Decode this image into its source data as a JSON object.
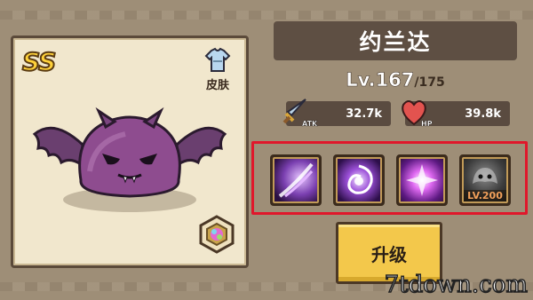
{
  "character": {
    "rarity": "SS",
    "name": "约兰达",
    "skin_label": "皮肤"
  },
  "level": {
    "current": "Lv.167",
    "max": "/175"
  },
  "stats": {
    "atk": {
      "tag": "ATK",
      "value": "32.7k"
    },
    "hp": {
      "tag": "HP",
      "value": "39.8k"
    }
  },
  "skills": [
    {
      "name": "slash-skill",
      "lock": ""
    },
    {
      "name": "vortex-skill",
      "lock": ""
    },
    {
      "name": "burst-skill",
      "lock": ""
    },
    {
      "name": "shadow-skill",
      "lock": "LV.200"
    }
  ],
  "upgrade_label": "升级",
  "watermark": "7tdown.com",
  "colors": {
    "highlight_border": "#e0172b",
    "button": "#f3c84b",
    "plate": "#5e4f43"
  }
}
